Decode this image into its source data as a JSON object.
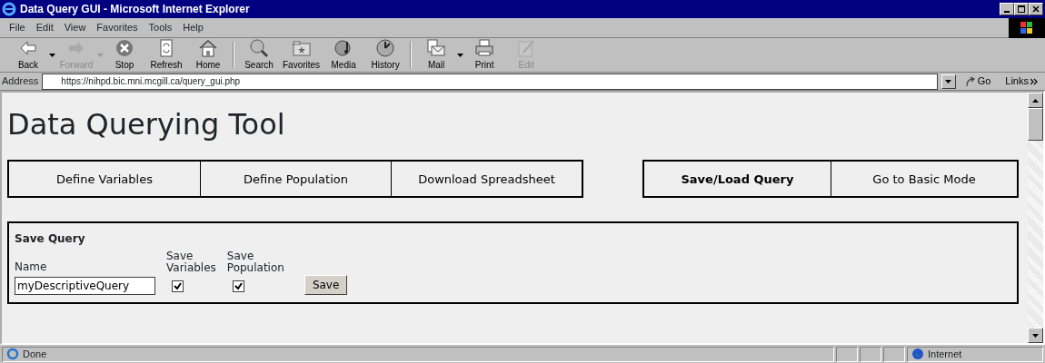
{
  "window": {
    "title": "Data Query GUI - Microsoft Internet Explorer"
  },
  "menu": [
    "File",
    "Edit",
    "View",
    "Favorites",
    "Tools",
    "Help"
  ],
  "toolbar": [
    {
      "label": "Back",
      "disabled": false,
      "dropdown": true
    },
    {
      "label": "Forward",
      "disabled": true,
      "dropdown": true
    },
    {
      "label": "Stop",
      "disabled": false,
      "dropdown": false
    },
    {
      "label": "Refresh",
      "disabled": false,
      "dropdown": false
    },
    {
      "label": "Home",
      "disabled": false,
      "dropdown": false
    },
    {
      "label": "Search",
      "disabled": false,
      "dropdown": false
    },
    {
      "label": "Favorites",
      "disabled": false,
      "dropdown": false
    },
    {
      "label": "Media",
      "disabled": false,
      "dropdown": false
    },
    {
      "label": "History",
      "disabled": false,
      "dropdown": false
    },
    {
      "label": "Mail",
      "disabled": false,
      "dropdown": true
    },
    {
      "label": "Print",
      "disabled": false,
      "dropdown": false
    },
    {
      "label": "Edit",
      "disabled": true,
      "dropdown": false
    }
  ],
  "address_bar": {
    "label": "Address",
    "value": "https://nihpd.bic.mni.mcgill.ca/query_gui.php",
    "go": "Go",
    "links": "Links"
  },
  "page": {
    "heading": "Data Querying Tool",
    "tab_groups": [
      [
        {
          "label": "Define Variables",
          "selected": false
        },
        {
          "label": "Define Population",
          "selected": false
        },
        {
          "label": "Download Spreadsheet",
          "selected": false
        }
      ],
      [
        {
          "label": "Save/Load Query",
          "selected": true
        },
        {
          "label": "Go to Basic Mode",
          "selected": false
        }
      ]
    ],
    "save_query": {
      "title": "Save Query",
      "name_label": "Name",
      "name_value": "myDescriptiveQuery",
      "options": [
        {
          "label": "Save Variables",
          "checked": true
        },
        {
          "label": "Save Population",
          "checked": true
        }
      ],
      "button": "Save"
    }
  },
  "status_bar": {
    "text": "Done",
    "zone": "Internet"
  }
}
